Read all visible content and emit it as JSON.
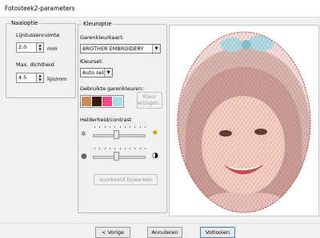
{
  "window": {
    "title": "Fotosteek2-parameters"
  },
  "stitch": {
    "legend": "Naaioptie",
    "spacing_label": "Lijntussenruimte",
    "spacing_value": "2.0",
    "spacing_unit": "mm",
    "density_label": "Max. dichtheid",
    "density_value": "4.5",
    "density_unit": "lijn/mm"
  },
  "color": {
    "legend": "Kleuroptie",
    "thread_chart_label": "Garenkleurkaart:",
    "thread_chart_value": "BROTHER EMBROIDERY",
    "color_set_label": "Kleurset:",
    "color_set_value": "Auto selectie",
    "used_colors_label": "Gebruikte garenkleuren:",
    "swatches": [
      "#c78d5c",
      "#3d1a0d",
      "#ef4a84",
      "#a9dbe8"
    ],
    "select_colors_button": "Kleur wijzigen..."
  },
  "brightness": {
    "label": "Helderheid/contrast",
    "brightness_level": 0.45,
    "contrast_level": 0.45
  },
  "refresh_button": "Voorbeeld bijwerken",
  "footer": {
    "back": "< Vorige",
    "cancel": "Annuleren",
    "finish": "Voltooien"
  }
}
